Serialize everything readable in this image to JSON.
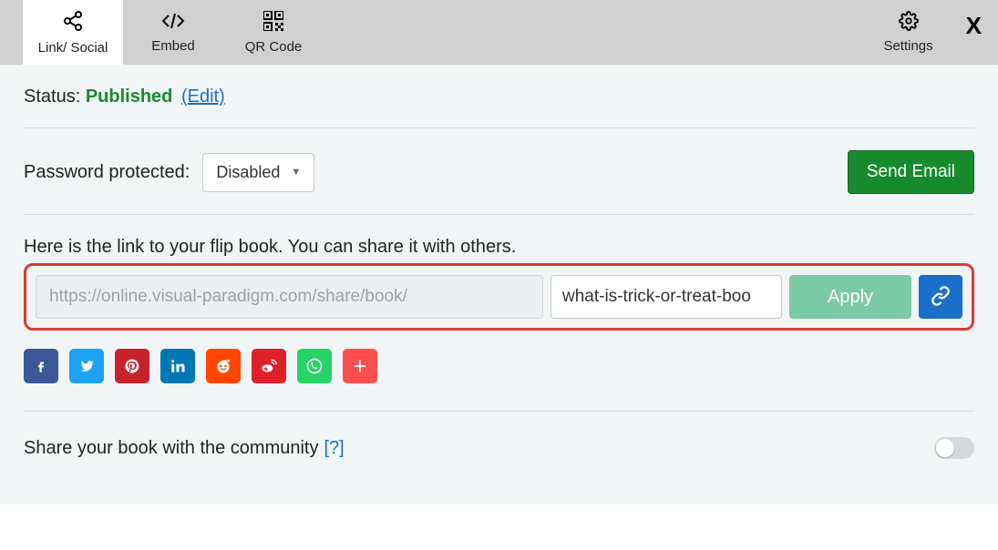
{
  "tabs": {
    "link_social": "Link/ Social",
    "embed": "Embed",
    "qrcode": "QR Code",
    "settings": "Settings"
  },
  "status": {
    "label": "Status:",
    "value": "Published",
    "edit": "(Edit)"
  },
  "password": {
    "label": "Password protected:",
    "value": "Disabled"
  },
  "send_email": "Send Email",
  "link": {
    "desc": "Here is the link to your flip book. You can share it with others.",
    "base": "https://online.visual-paradigm.com/share/book/",
    "slug": "what-is-trick-or-treat-boo",
    "apply": "Apply"
  },
  "social": {
    "facebook": "f",
    "twitter": "t",
    "pinterest": "p",
    "linkedin": "in",
    "reddit": "r",
    "weibo": "w",
    "whatsapp": "wa",
    "more": "+"
  },
  "community": {
    "label": "Share your book with the community",
    "help": "[?]"
  }
}
